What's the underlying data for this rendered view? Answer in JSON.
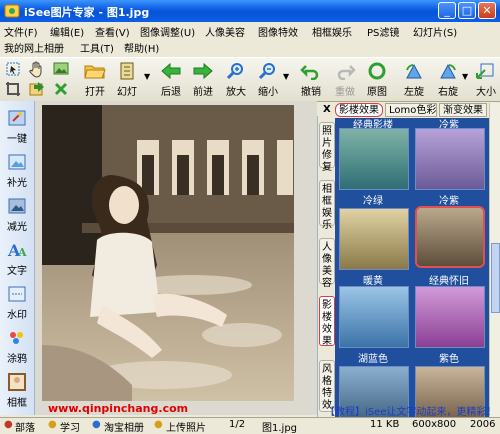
{
  "window": {
    "title": "iSee图片专家 - 图1.jpg",
    "min": "_",
    "max": "□",
    "close": "✕"
  },
  "menu": {
    "row1": [
      "文件(F)",
      "编辑(E)",
      "查看(V)",
      "图像调整(U)",
      "人像美容",
      "图像特效",
      "相框娱乐",
      "PS滤镜",
      "幻灯片(S)"
    ],
    "row2": [
      "我的网上相册",
      "工具(T)",
      "帮助(H)"
    ]
  },
  "toolbar": {
    "open": "打开",
    "slideshow": "幻灯",
    "back": "后退",
    "forward": "前进",
    "zoom_in": "放大",
    "zoom_out": "缩小",
    "undo": "撤销",
    "redo": "重做",
    "original": "原图",
    "rotate_left": "左旋",
    "rotate_right": "右旋",
    "size": "大小"
  },
  "sidebar": {
    "items": [
      "一键",
      "补光",
      "减光",
      "文字",
      "水印",
      "涂鸦",
      "相框"
    ]
  },
  "canvas": {
    "close": "X"
  },
  "panel": {
    "htabs": [
      "影楼效果",
      "Lomo色彩",
      "渐变效果"
    ],
    "vtabs": [
      "照片修复",
      "相框娱乐",
      "人像美容",
      "影楼效果",
      "风格特效"
    ],
    "top_partial": [
      "经典影楼",
      "冷紫"
    ],
    "thumbs": [
      "冷绿",
      "冷紫",
      "暖黄",
      "经典怀旧",
      "湖蓝色",
      "紫色"
    ]
  },
  "overlay": {
    "website": "www.qinpinchang.com",
    "ad": "【教程】iSee让文字动起来，更精彩！"
  },
  "statusbar": {
    "items": [
      "部落",
      "学习",
      "淘宝相册",
      "上传照片"
    ],
    "page": "1/2",
    "filename": "图1.jpg",
    "filesize": "11 KB",
    "dimensions": "600x800",
    "date": "2006"
  },
  "colors": {
    "titlebar": "#0a5ae0",
    "panel": "#1f4f9d",
    "highlight": "#e05050"
  }
}
